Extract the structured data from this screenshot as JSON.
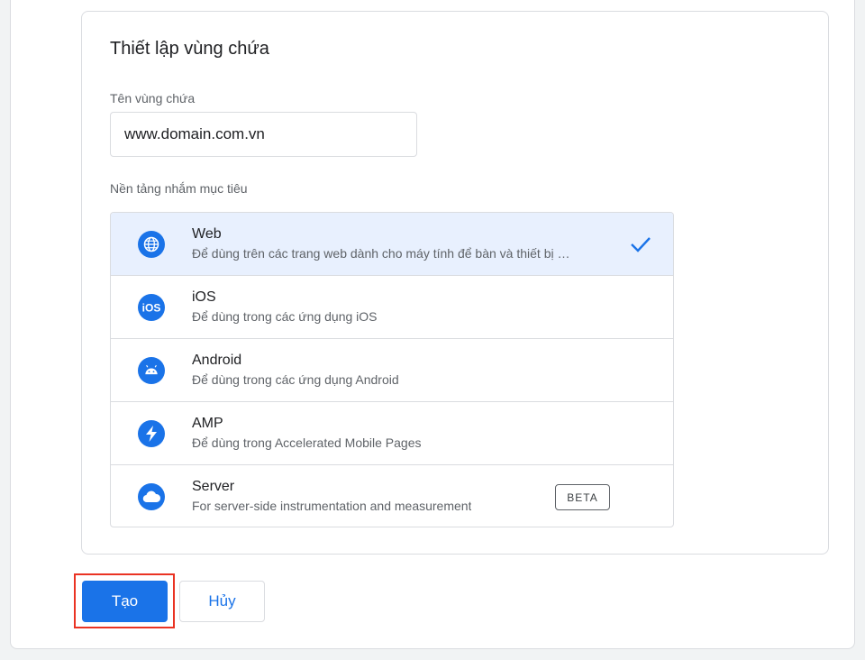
{
  "card": {
    "title": "Thiết lập vùng chứa",
    "name_label": "Tên vùng chứa",
    "name_value": "www.domain.com.vn",
    "platform_label": "Nền tảng nhắm mục tiêu"
  },
  "platforms": [
    {
      "title": "Web",
      "description": "Để dùng trên các trang web dành cho máy tính để bàn và thiết bị di động",
      "icon": "globe-icon",
      "selected": true
    },
    {
      "title": "iOS",
      "description": "Để dùng trong các ứng dụng iOS",
      "icon": "ios-icon",
      "selected": false
    },
    {
      "title": "Android",
      "description": "Để dùng trong các ứng dụng Android",
      "icon": "android-icon",
      "selected": false
    },
    {
      "title": "AMP",
      "description": "Để dùng trong Accelerated Mobile Pages",
      "icon": "bolt-icon",
      "selected": false
    },
    {
      "title": "Server",
      "description": "For server-side instrumentation and measurement",
      "icon": "cloud-icon",
      "selected": false,
      "badge": "BETA"
    }
  ],
  "actions": {
    "create_label": "Tạo",
    "cancel_label": "Hủy"
  },
  "colors": {
    "accent": "#1a73e8",
    "selected_bg": "#e8f0fe",
    "highlight": "#ea3323"
  }
}
